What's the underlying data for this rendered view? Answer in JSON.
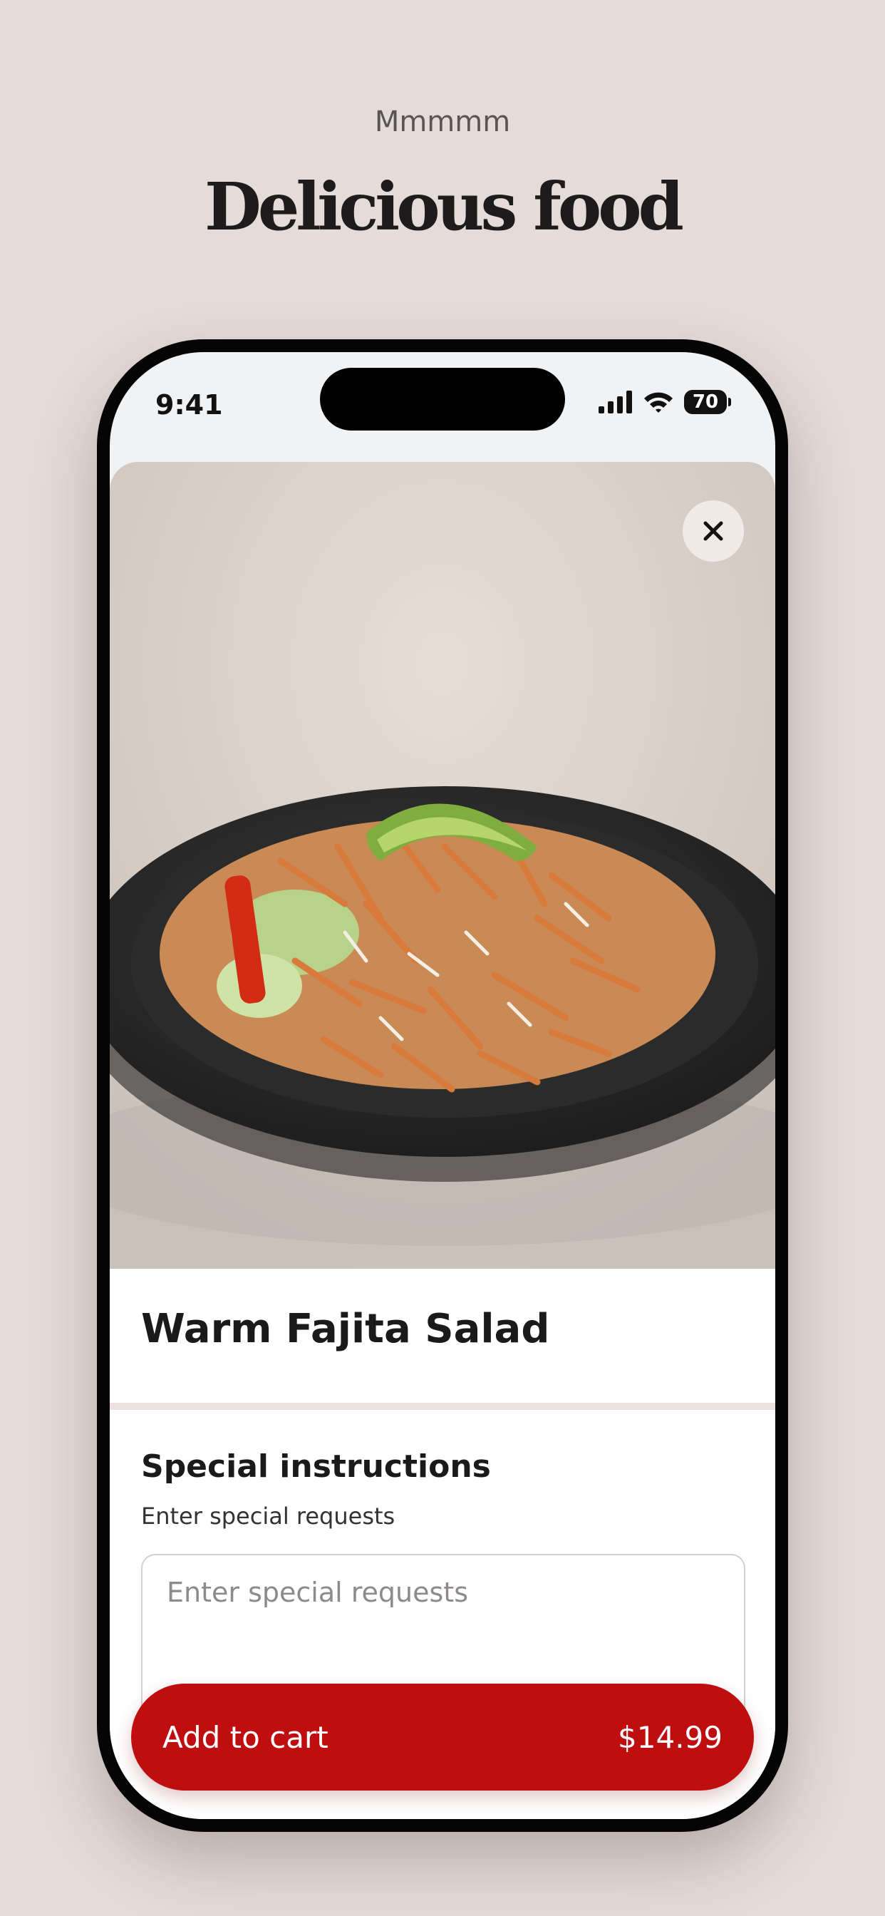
{
  "page": {
    "eyebrow": "Mmmmm",
    "headline": "Delicious food"
  },
  "status_bar": {
    "time": "9:41",
    "battery": "70",
    "icons": [
      "cellular-signal-icon",
      "wifi-icon",
      "battery-icon"
    ]
  },
  "item": {
    "image": "warm-fajita-salad-photo",
    "close_icon": "close-icon",
    "title": "Warm Fajita Salad"
  },
  "special_instructions": {
    "title": "Special instructions",
    "subtitle": "Enter special requests",
    "placeholder": "Enter special requests",
    "value": ""
  },
  "cart_button": {
    "label": "Add to cart",
    "price": "$14.99"
  },
  "colors": {
    "background": "#e5dbd9",
    "accent": "#bf0e10",
    "text": "#1a1a1a"
  }
}
